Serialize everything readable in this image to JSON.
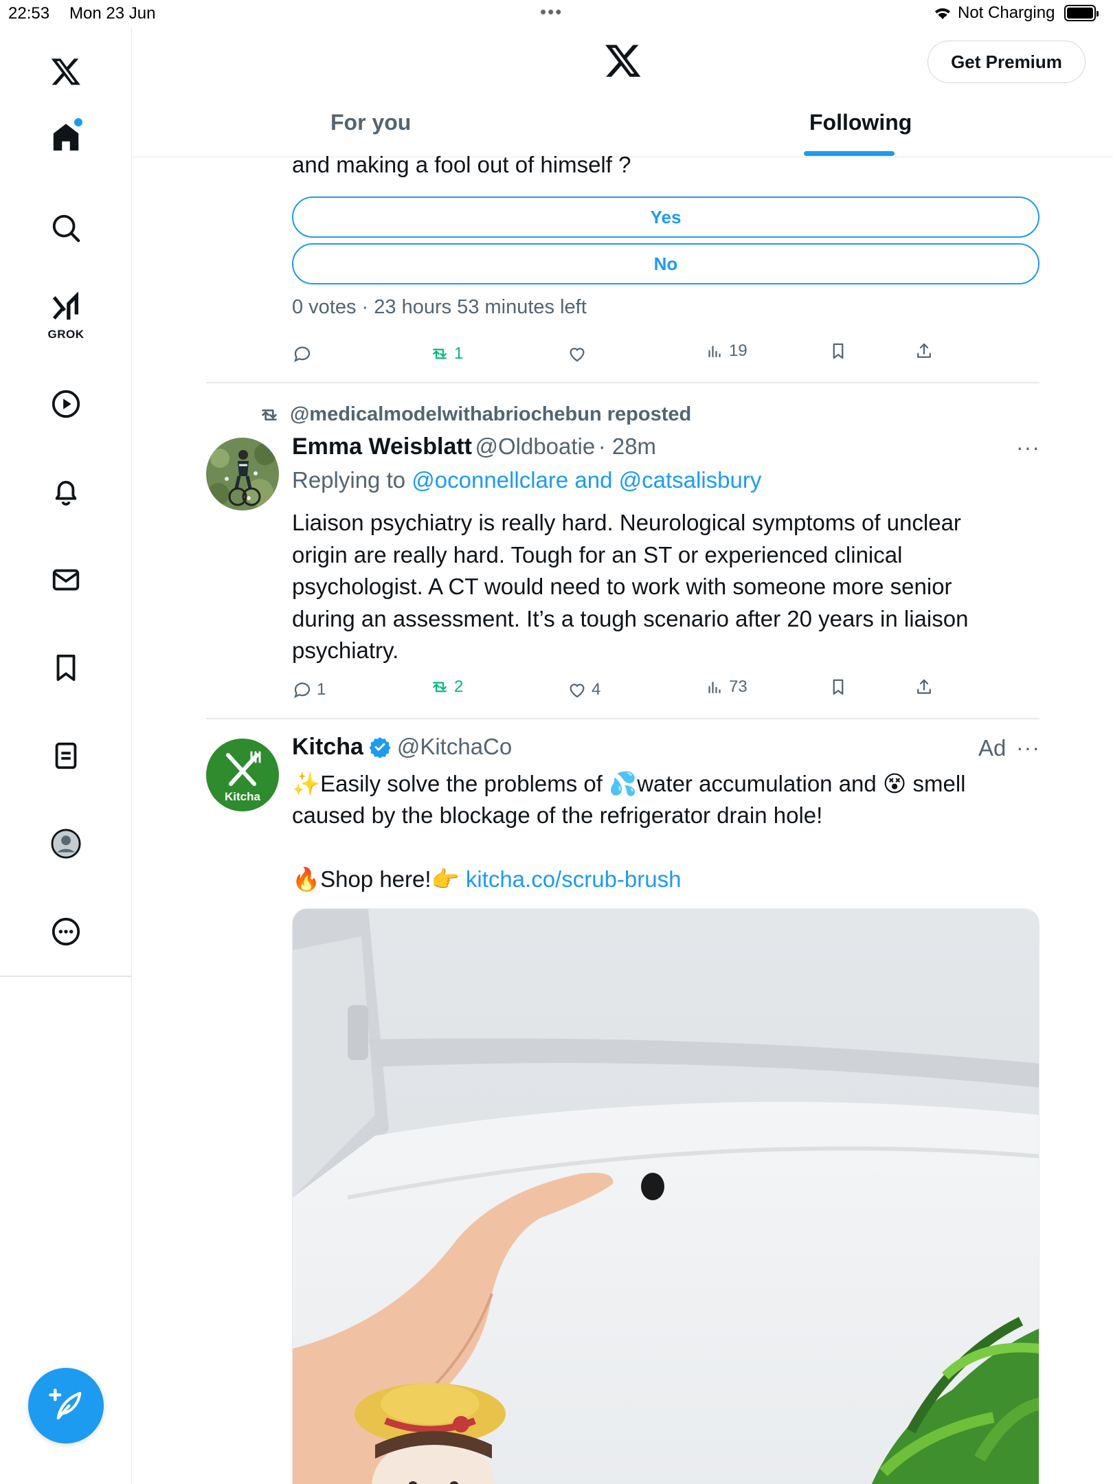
{
  "status_bar": {
    "time": "22:53",
    "date": "Mon 23 Jun",
    "charging": "Not Charging"
  },
  "sidebar": {
    "grok_label": "GROK",
    "items": [
      {
        "icon": "x-logo-icon"
      },
      {
        "icon": "home-icon",
        "active": true
      },
      {
        "icon": "search-icon"
      },
      {
        "icon": "grok-icon"
      },
      {
        "icon": "video-play-icon"
      },
      {
        "icon": "bell-icon"
      },
      {
        "icon": "mail-icon"
      },
      {
        "icon": "bookmark-icon"
      },
      {
        "icon": "list-icon"
      },
      {
        "icon": "profile-avatar-icon"
      },
      {
        "icon": "more-circle-icon"
      }
    ],
    "compose_icon": "compose-post-icon"
  },
  "header": {
    "premium_label": "Get Premium",
    "tabs": [
      {
        "label": "For you",
        "active": false
      },
      {
        "label": "Following",
        "active": true
      }
    ]
  },
  "feed": {
    "poll_post": {
      "text_tail": "and making a fool out of himself ?",
      "options": [
        {
          "label": "Yes"
        },
        {
          "label": "No"
        }
      ],
      "meta": "0 votes · 23 hours 53 minutes left",
      "actions": {
        "replies": "",
        "reposts": "1",
        "likes": "",
        "views": "19"
      }
    },
    "reply_post": {
      "repost_by": "@medicalmodelwithabriochebun reposted",
      "name": "Emma Weisblatt",
      "handle": "@Oldboatie",
      "time": "· 28m",
      "replying_prefix": "Replying to ",
      "replying_to": "@oconnellclare and @catsalisbury",
      "text": "Liaison psychiatry is really hard. Neurological symptoms of unclear origin are really hard. Tough for an ST or experienced clinical psychologist. A CT would need to work with someone more senior during an assessment. It’s a tough scenario after 20 years in liaison psychiatry.",
      "actions": {
        "replies": "1",
        "reposts": "2",
        "likes": "4",
        "views": "73"
      }
    },
    "ad_post": {
      "name": "Kitcha",
      "handle": "@KitchaCo",
      "ad_label": "Ad",
      "avatar_label": "Kitcha",
      "line1_sparkle": "✨",
      "line1_a": "Easily solve the problems of ",
      "line1_drops": "💦",
      "line1_b": "water accumulation and ",
      "line1_face": "😵",
      "line1_c": " smell",
      "line2": "caused by the blockage of the refrigerator drain hole!",
      "shop_fire": "🔥",
      "shop_text": "Shop here!",
      "shop_point": "👉",
      "shop_link": "kitcha.co/scrub-brush"
    }
  }
}
